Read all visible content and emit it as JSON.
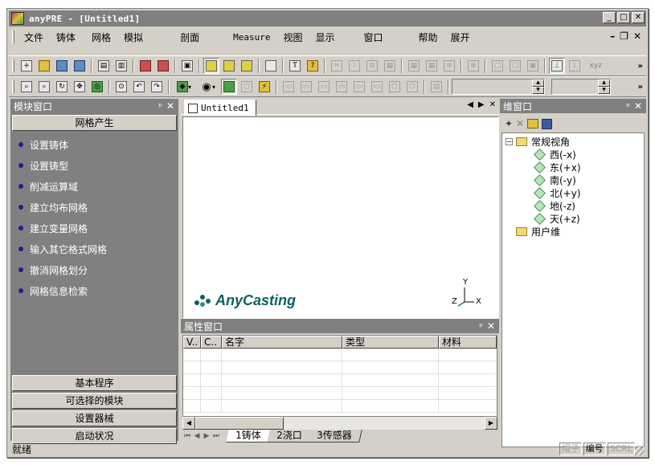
{
  "window": {
    "title": "anyPRE - [Untitled1]"
  },
  "menubar": {
    "items": [
      "文件",
      "铸体",
      "网格",
      "模拟",
      "剖面",
      "Measure",
      "视图",
      "显示",
      "窗口",
      "帮助",
      "展开"
    ]
  },
  "toolbar1": {
    "icons": [
      "new-icon",
      "open-icon",
      "save-icon",
      "save-all-icon",
      "print-icon",
      "print-preview-icon",
      "import-icon",
      "export-icon",
      "paste-icon",
      "layout-1-icon",
      "layout-2-icon",
      "layout-3-icon",
      "layout-4-icon",
      "text-icon",
      "help-icon",
      "cut-icon",
      "grid-icon",
      "copy-icon",
      "properties-icon",
      "table-icon",
      "table-2-icon",
      "stack-icon",
      "stack-2-icon",
      "frame-icon",
      "frame-2-icon",
      "frame-3-icon",
      "axis-icon",
      "axis-2-icon",
      "xyz-icon"
    ],
    "xyz_label": "xyz"
  },
  "toolbar2": {
    "icons": [
      "zoom-window-icon",
      "zoom-fit-icon",
      "rotate-icon",
      "pan-icon",
      "target-icon",
      "orbit-icon",
      "undo-view-icon",
      "redo-view-icon",
      "shape-icon",
      "eye-icon",
      "solid-icon",
      "wireframe-icon",
      "lightning-icon",
      "front-icon",
      "back-icon",
      "left-icon",
      "right-icon",
      "top-icon",
      "bottom-icon",
      "iso-icon",
      "perspective-icon",
      "screen-icon"
    ]
  },
  "left_panel": {
    "title": "模块窗口",
    "group_active": "网格产生",
    "items": [
      "设置铸体",
      "设置铸型",
      "削减运算域",
      "建立均布网格",
      "建立变量网格",
      "输入其它格式网格",
      "撤消网格划分",
      "网格信息检索"
    ],
    "groups_bottom": [
      "基本程序",
      "可选择的模块",
      "设置器械",
      "启动状况"
    ]
  },
  "document": {
    "tab_label": "Untitled1",
    "logo_text": "AnyCasting",
    "axis_x": "X",
    "axis_y": "Y",
    "axis_z": "Z"
  },
  "properties": {
    "title": "属性窗口",
    "columns": [
      "V..",
      "C..",
      "名字",
      "类型",
      "材料"
    ],
    "sheet_tabs": [
      "1铸体",
      "2浇口",
      "3传感器"
    ]
  },
  "right_panel": {
    "title": "维窗口",
    "tree": {
      "root": "常规视角",
      "children": [
        "西(-x)",
        "东(+x)",
        "南(-y)",
        "北(+y)",
        "地(-z)",
        "天(+z)"
      ],
      "user": "用户维"
    }
  },
  "statusbar": {
    "text": "就绪",
    "indicators": [
      "帽子",
      "编号",
      "SCRL"
    ]
  }
}
